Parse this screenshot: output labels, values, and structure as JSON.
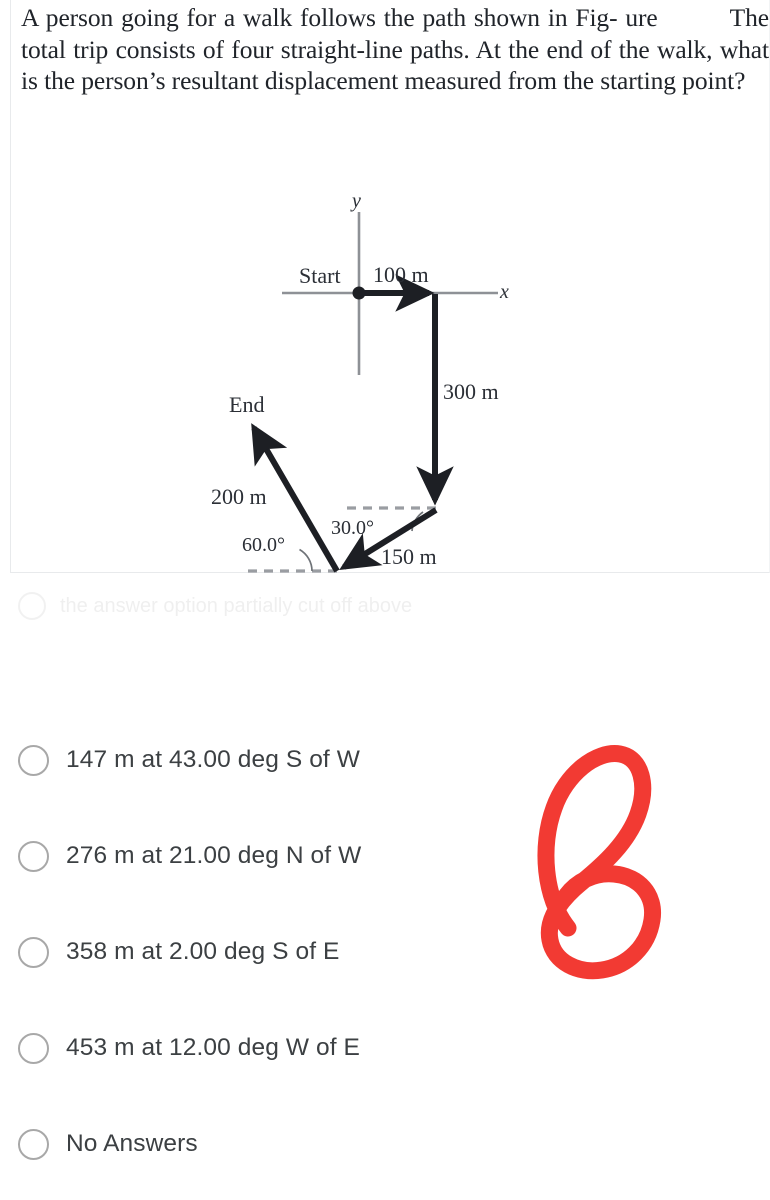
{
  "question": {
    "text_part1": "A person going for a walk follows the path shown in Fig-",
    "text_part2": "ure",
    "text_part3": "The total trip consists of four straight-line paths. At the end of the walk, what is the person’s resultant displacement measured from the starting point?",
    "full_text": "A person going for a walk follows the path shown in Figure       The total trip consists of four straight-line paths. At the end of the walk, what is the person’s resultant displacement measured from the starting point?"
  },
  "figure": {
    "axis_y_label": "y",
    "axis_x_label": "x",
    "start_label": "Start",
    "end_label": "End",
    "leg1_label": "100 m",
    "leg2_label": "300 m",
    "leg3_label": "150 m",
    "leg4_label": "200 m",
    "angle1_label": "30.0°",
    "angle2_label": "60.0°",
    "stroke_color": "#1d1f24",
    "axis_color": "#8e9196",
    "dash_color": "#9a9da2"
  },
  "chart_data": {
    "type": "diagram",
    "title": "Four straight-line walking path vectors",
    "origin": "Start",
    "terminus": "End",
    "legs": [
      {
        "index": 1,
        "magnitude": 100,
        "unit": "m",
        "label": "100 m",
        "direction_deg": 0,
        "description": "east along +x axis"
      },
      {
        "index": 2,
        "magnitude": 300,
        "unit": "m",
        "label": "300 m",
        "direction_deg": 270,
        "description": "straight down (south)"
      },
      {
        "index": 3,
        "magnitude": 150,
        "unit": "m",
        "label": "150 m",
        "direction_deg": 210,
        "angle_label": "30.0°",
        "description": "down and to the left, 30.0 degrees below horizontal"
      },
      {
        "index": 4,
        "magnitude": 200,
        "unit": "m",
        "label": "200 m",
        "direction_deg": 120,
        "angle_label": "60.0°",
        "description": "up and to the left, 60.0 degrees above horizontal"
      }
    ],
    "angles": [
      "30.0°",
      "60.0°"
    ],
    "axis_labels": {
      "x": "x",
      "y": "y"
    }
  },
  "faded_row": {
    "text": "the answer option partially cut off above"
  },
  "options": [
    {
      "id": "opt-1",
      "label": "147 m at 43.00 deg S of W",
      "selected": false
    },
    {
      "id": "opt-2",
      "label": "276 m at 21.00 deg N of W",
      "selected": false
    },
    {
      "id": "opt-3",
      "label": "358 m at 2.00 deg S of E",
      "selected": false
    },
    {
      "id": "opt-4",
      "label": "453 m at 12.00 deg W of E",
      "selected": false
    },
    {
      "id": "opt-5",
      "label": "No Answers",
      "selected": false
    }
  ],
  "annotation": {
    "symbol": "8",
    "color": "#f23a33",
    "description": "handwritten red digit eight"
  }
}
